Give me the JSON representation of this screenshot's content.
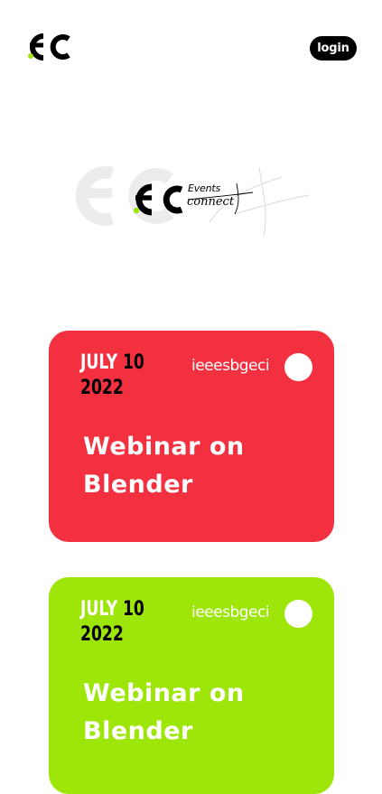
{
  "header": {
    "logo_name": "ec-logo",
    "login_label": "login"
  },
  "hero": {
    "events_text": "Events",
    "connect_text": "connect"
  },
  "events": [
    {
      "month": "JULY",
      "day": "10",
      "year": "2022",
      "organizer": "ieeesbgeci",
      "title": "Webinar on Blender",
      "color": "#f2303f"
    },
    {
      "month": "JULY",
      "day": "10",
      "year": "2022",
      "organizer": "ieeesbgeci",
      "title": "Webinar on Blender",
      "color": "#9ee509"
    }
  ],
  "colors": {
    "accent_green": "#9ee509",
    "accent_red": "#f2303f",
    "dark": "#000000"
  }
}
